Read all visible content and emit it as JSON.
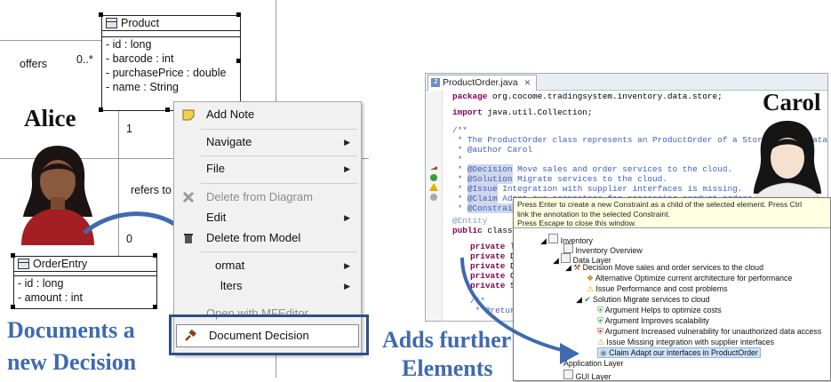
{
  "left": {
    "diagram": {
      "product_class": {
        "title": "Product",
        "attributes": [
          "- id : long",
          "- barcode : int",
          "- purchasePrice : double",
          "- name : String"
        ]
      },
      "order_entry_class": {
        "title": "OrderEntry",
        "attributes": [
          "- id : long",
          "- amount : int"
        ]
      },
      "labels": {
        "offers": "offers",
        "multiplicity_top": "0..*",
        "one": "1",
        "refers_to": "refers to",
        "zero": "0"
      }
    },
    "person_name": "Alice",
    "caption_line1": "Documents a",
    "caption_line2": "new Decision",
    "menu": {
      "add_note": "Add Note",
      "navigate": "Navigate",
      "file": "File",
      "delete_from_diagram": "Delete from Diagram",
      "edit": "Edit",
      "delete_from_model": "Delete from Model",
      "format": "ormat",
      "filters": "lters",
      "open_with": "Open with MFEditor",
      "document_decision": "Document Decision"
    }
  },
  "right": {
    "tab_title": "ProductOrder.java",
    "person_name": "Carol",
    "caption_line1": "Adds further",
    "caption_line2": "Elements",
    "code": {
      "package_kw": "package",
      "package_rest": " org.cocome.tradingsystem.inventory.data.store;",
      "import_kw": "import",
      "import_rest": " java.util.Collection;",
      "comment_open": "/**",
      "comment_desc": " * The ProductOrder class represents an ProductOrder of a Store in the databas",
      "comment_author": " * @author Carol",
      "comment_star": " *",
      "decision_tag": "@Decision",
      "decision_text": " Move sales and order services to the cloud.",
      "solution_tag": "@Solution",
      "solution_text": " Migrate services to the cloud.",
      "issue_tag": "@Issue",
      "issue_text": " Integration with supplier interfaces is missing.",
      "claim_tag": "@Claim",
      "claim_text": " Adapt our connectors for processing product orders.",
      "constraint_tag": "@Constraint",
      "entity": "@Entity",
      "public_kw": "public",
      "public_rest": " class P",
      "private_kw": "private",
      "private_rest": [
        " lo",
        " Da",
        " Da",
        " Co",
        " St"
      ],
      "javadoc_open": "/**",
      "return_tag": " * @return",
      "javadoc_close": " */"
    },
    "popup": {
      "hint_line1": "Press Enter to create a new Constraint as a child of the selected element. Press Ctrl",
      "hint_line2": "link the annotation to the selected Constraint.",
      "hint_line3": "Press Escape to close this window.",
      "tree": [
        "Inventory",
        "Inventory Overview",
        "Data Layer",
        "Decision Move sales and order services to the cloud",
        "Alternative Optimize current architecture for performance",
        "Issue Performance and cost problems",
        "Solution Migrate services to cloud",
        "Argument Helps to optimize costs",
        "Argument Improves scalability",
        "Argument Increased vulnerability for unauthorized data access",
        "Issue Missing integration with supplier interfaces",
        "Claim Adapt our interfaces in ProductOrder",
        "Application Layer",
        "GUI Layer"
      ]
    }
  },
  "colors": {
    "caption_blue": "#3e6ab0",
    "highlight_border": "#2f4f87",
    "java_keyword": "#7f0055",
    "javadoc": "#3f5fbf"
  }
}
